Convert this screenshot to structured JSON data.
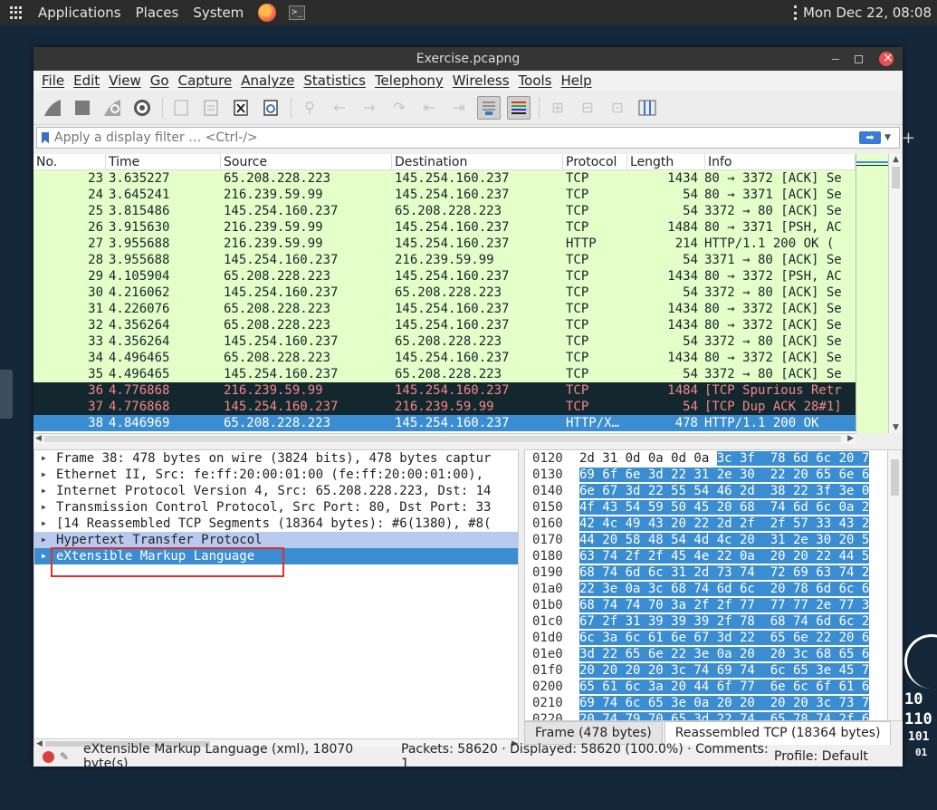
{
  "top_panel": {
    "menus": [
      "Applications",
      "Places",
      "System"
    ],
    "clock": "Mon Dec 22, 08:08"
  },
  "window": {
    "title": "Exercise.pcapng",
    "menu": [
      "File",
      "Edit",
      "View",
      "Go",
      "Capture",
      "Analyze",
      "Statistics",
      "Telephony",
      "Wireless",
      "Tools",
      "Help"
    ],
    "filter_placeholder": "Apply a display filter … <Ctrl-/>"
  },
  "packet_list": {
    "columns": [
      "No.",
      "Time",
      "Source",
      "Destination",
      "Protocol",
      "Length",
      "Info"
    ],
    "rows": [
      {
        "no": "23",
        "time": "3.635227",
        "src": "65.208.228.223",
        "dst": "145.254.160.237",
        "proto": "TCP",
        "len": "1434",
        "info": "80 → 3372 [ACK] Se",
        "style": "green"
      },
      {
        "no": "24",
        "time": "3.645241",
        "src": "216.239.59.99",
        "dst": "145.254.160.237",
        "proto": "TCP",
        "len": "54",
        "info": "80 → 3371 [ACK] Se",
        "style": "green"
      },
      {
        "no": "25",
        "time": "3.815486",
        "src": "145.254.160.237",
        "dst": "65.208.228.223",
        "proto": "TCP",
        "len": "54",
        "info": "3372 → 80 [ACK] Se",
        "style": "green"
      },
      {
        "no": "26",
        "time": "3.915630",
        "src": "216.239.59.99",
        "dst": "145.254.160.237",
        "proto": "TCP",
        "len": "1484",
        "info": "80 → 3371 [PSH, AC",
        "style": "green"
      },
      {
        "no": "27",
        "time": "3.955688",
        "src": "216.239.59.99",
        "dst": "145.254.160.237",
        "proto": "HTTP",
        "len": "214",
        "info": "HTTP/1.1 200 OK  (",
        "style": "green"
      },
      {
        "no": "28",
        "time": "3.955688",
        "src": "145.254.160.237",
        "dst": "216.239.59.99",
        "proto": "TCP",
        "len": "54",
        "info": "3371 → 80 [ACK] Se",
        "style": "green"
      },
      {
        "no": "29",
        "time": "4.105904",
        "src": "65.208.228.223",
        "dst": "145.254.160.237",
        "proto": "TCP",
        "len": "1434",
        "info": "80 → 3372 [PSH, AC",
        "style": "green"
      },
      {
        "no": "30",
        "time": "4.216062",
        "src": "145.254.160.237",
        "dst": "65.208.228.223",
        "proto": "TCP",
        "len": "54",
        "info": "3372 → 80 [ACK] Se",
        "style": "green"
      },
      {
        "no": "31",
        "time": "4.226076",
        "src": "65.208.228.223",
        "dst": "145.254.160.237",
        "proto": "TCP",
        "len": "1434",
        "info": "80 → 3372 [ACK] Se",
        "style": "green"
      },
      {
        "no": "32",
        "time": "4.356264",
        "src": "65.208.228.223",
        "dst": "145.254.160.237",
        "proto": "TCP",
        "len": "1434",
        "info": "80 → 3372 [ACK] Se",
        "style": "green"
      },
      {
        "no": "33",
        "time": "4.356264",
        "src": "145.254.160.237",
        "dst": "65.208.228.223",
        "proto": "TCP",
        "len": "54",
        "info": "3372 → 80 [ACK] Se",
        "style": "green"
      },
      {
        "no": "34",
        "time": "4.496465",
        "src": "65.208.228.223",
        "dst": "145.254.160.237",
        "proto": "TCP",
        "len": "1434",
        "info": "80 → 3372 [ACK] Se",
        "style": "green"
      },
      {
        "no": "35",
        "time": "4.496465",
        "src": "145.254.160.237",
        "dst": "65.208.228.223",
        "proto": "TCP",
        "len": "54",
        "info": "3372 → 80 [ACK] Se",
        "style": "green"
      },
      {
        "no": "36",
        "time": "4.776868",
        "src": "216.239.59.99",
        "dst": "145.254.160.237",
        "proto": "TCP",
        "len": "1484",
        "info": "[TCP Spurious Retr",
        "style": "black"
      },
      {
        "no": "37",
        "time": "4.776868",
        "src": "145.254.160.237",
        "dst": "216.239.59.99",
        "proto": "TCP",
        "len": "54",
        "info": "[TCP Dup ACK 28#1]",
        "style": "black"
      },
      {
        "no": "38",
        "time": "4.846969",
        "src": "65.208.228.223",
        "dst": "145.254.160.237",
        "proto": "HTTP/X…",
        "len": "478",
        "info": "HTTP/1.1 200 OK",
        "style": "selected"
      }
    ]
  },
  "details": {
    "rows": [
      {
        "text": "Frame 38: 478 bytes on wire (3824 bits), 478 bytes captur",
        "style": ""
      },
      {
        "text": "Ethernet II, Src: fe:ff:20:00:01:00 (fe:ff:20:00:01:00),",
        "style": ""
      },
      {
        "text": "Internet Protocol Version 4, Src: 65.208.228.223, Dst: 14",
        "style": ""
      },
      {
        "text": "Transmission Control Protocol, Src Port: 80, Dst Port: 33",
        "style": ""
      },
      {
        "text": "[14 Reassembled TCP Segments (18364 bytes): #6(1380), #8(",
        "style": ""
      },
      {
        "text": "Hypertext Transfer Protocol",
        "style": "hilite"
      },
      {
        "text": "eXtensible Markup Language",
        "style": "sel"
      }
    ]
  },
  "bytes": {
    "rows": [
      {
        "off": "0120",
        "plain": "2d 31 0d 0a 0d 0a ",
        "hl": "3c 3f  78 6d 6c 20 7"
      },
      {
        "off": "0130",
        "plain": "",
        "hl": "69 6f 6e 3d 22 31 2e 30  22 20 65 6e 6"
      },
      {
        "off": "0140",
        "plain": "",
        "hl": "6e 67 3d 22 55 54 46 2d  38 22 3f 3e 0"
      },
      {
        "off": "0150",
        "plain": "",
        "hl": "4f 43 54 59 50 45 20 68  74 6d 6c 0a 2"
      },
      {
        "off": "0160",
        "plain": "",
        "hl": "42 4c 49 43 20 22 2d 2f  2f 57 33 43 2"
      },
      {
        "off": "0170",
        "plain": "",
        "hl": "44 20 58 48 54 4d 4c 20  31 2e 30 20 5"
      },
      {
        "off": "0180",
        "plain": "",
        "hl": "63 74 2f 2f 45 4e 22 0a  20 20 22 44 5"
      },
      {
        "off": "0190",
        "plain": "",
        "hl": "68 74 6d 6c 31 2d 73 74  72 69 63 74 2"
      },
      {
        "off": "01a0",
        "plain": "",
        "hl": "22 3e 0a 3c 68 74 6d 6c  20 78 6d 6c 6"
      },
      {
        "off": "01b0",
        "plain": "",
        "hl": "68 74 74 70 3a 2f 2f 77  77 77 2e 77 3"
      },
      {
        "off": "01c0",
        "plain": "",
        "hl": "67 2f 31 39 39 39 2f 78  68 74 6d 6c 2"
      },
      {
        "off": "01d0",
        "plain": "",
        "hl": "6c 3a 6c 61 6e 67 3d 22  65 6e 22 20 6"
      },
      {
        "off": "01e0",
        "plain": "",
        "hl": "3d 22 65 6e 22 3e 0a 20  20 3c 68 65 6"
      },
      {
        "off": "01f0",
        "plain": "",
        "hl": "20 20 20 20 3c 74 69 74  6c 65 3e 45 7"
      },
      {
        "off": "0200",
        "plain": "",
        "hl": "65 61 6c 3a 20 44 6f 77  6e 6c 6f 61 6"
      },
      {
        "off": "0210",
        "plain": "",
        "hl": "69 74 6c 65 3e 0a 20 20  20 20 3c 73 7"
      },
      {
        "off": "0220",
        "plain": "",
        "hl": "20 74 79 70 65 3d 22 74  65 78 74 2f 6"
      }
    ],
    "tabs": [
      "Frame (478 bytes)",
      "Reassembled TCP (18364 bytes)"
    ]
  },
  "status": {
    "field": "eXtensible Markup Language (xml), 18070 byte(s)",
    "packets": "Packets: 58620 · Displayed: 58620 (100.0%) · Comments: 1",
    "profile": "Profile: Default"
  },
  "deco_text": [
    "10",
    "110",
    "101",
    "01"
  ]
}
